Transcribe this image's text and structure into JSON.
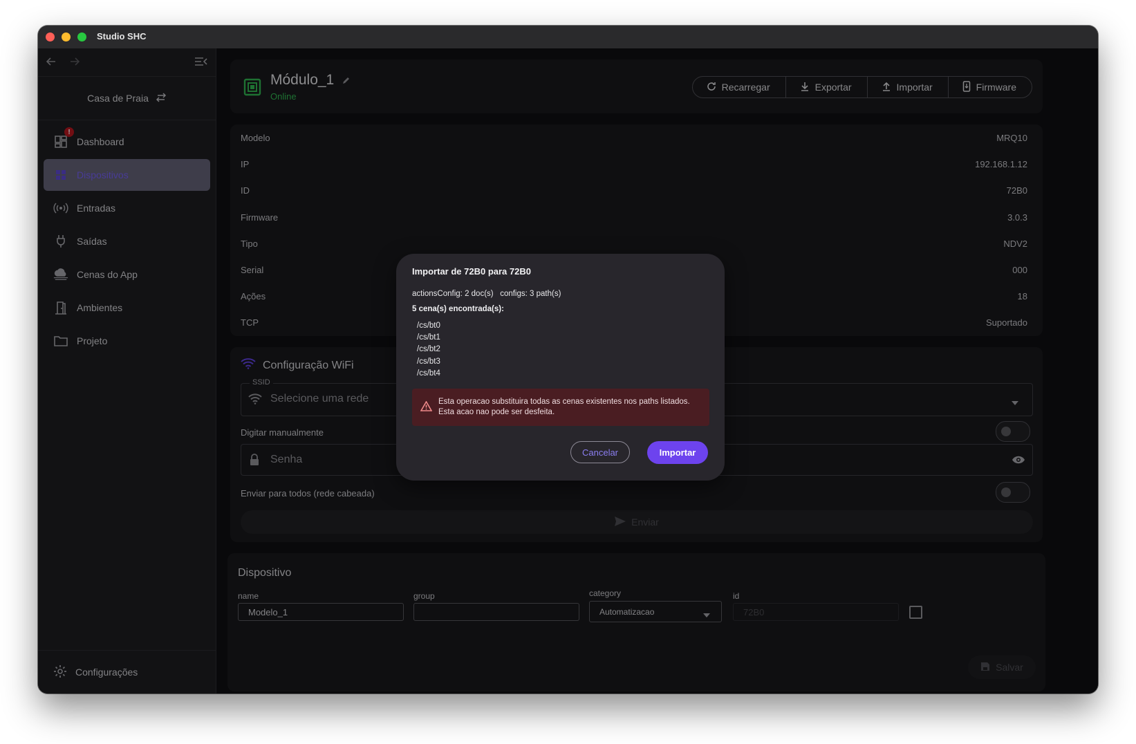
{
  "window": {
    "title": "Studio SHC"
  },
  "sidebar": {
    "house": "Casa de Praia",
    "items": [
      {
        "label": "Dashboard",
        "icon": "dashboard-icon",
        "badge": "!"
      },
      {
        "label": "Dispositivos",
        "icon": "devices-icon",
        "active": true
      },
      {
        "label": "Entradas",
        "icon": "broadcast-icon"
      },
      {
        "label": "Saídas",
        "icon": "plug-icon"
      },
      {
        "label": "Cenas do App",
        "icon": "cloud-icon"
      },
      {
        "label": "Ambientes",
        "icon": "door-icon"
      },
      {
        "label": "Projeto",
        "icon": "folder-icon"
      }
    ],
    "settings": "Configurações"
  },
  "header": {
    "title": "Módulo_1",
    "status": "Online",
    "buttons": {
      "reload": "Recarregar",
      "export": "Exportar",
      "import": "Importar",
      "firmware": "Firmware"
    }
  },
  "info": {
    "rows": [
      {
        "key": "Modelo",
        "value": "MRQ10"
      },
      {
        "key": "IP",
        "value": "192.168.1.12"
      },
      {
        "key": "ID",
        "value": "72B0"
      },
      {
        "key": "Firmware",
        "value": "3.0.3"
      },
      {
        "key": "Tipo",
        "value": "NDV2"
      },
      {
        "key": "Serial",
        "value": "000"
      },
      {
        "key": "Ações",
        "value": "18"
      },
      {
        "key": "TCP",
        "value": "Suportado"
      }
    ]
  },
  "wifi": {
    "title": "Configuração WiFi",
    "ssid_label": "SSID",
    "ssid_placeholder": "Selecione uma rede",
    "manual_label": "Digitar manualmente",
    "password_placeholder": "Senha",
    "broadcast_label": "Enviar para todos (rede cabeada)",
    "send": "Enviar"
  },
  "device": {
    "title": "Dispositivo",
    "name_label": "name",
    "name_value": "Modelo_1",
    "group_label": "group",
    "group_value": "",
    "category_label": "category",
    "category_value": "Automatizacao",
    "id_label": "id",
    "id_value": "72B0",
    "save": "Salvar"
  },
  "dialog": {
    "title": "Importar de 72B0 para 72B0",
    "stats": "actionsConfig: 2 doc(s)   configs: 3 path(s)",
    "count": "5 cena(s) encontrada(s):",
    "paths": [
      "/cs/bt0",
      "/cs/bt1",
      "/cs/bt2",
      "/cs/bt3",
      "/cs/bt4"
    ],
    "warning": "Esta operacao substituira todas as cenas existentes nos paths listados. Esta acao nao pode ser desfeita.",
    "cancel": "Cancelar",
    "confirm": "Importar"
  },
  "colors": {
    "accent": "#6d43ee",
    "online": "#2fae4e",
    "warning_bg": "#4a1d22",
    "badge": "#b0161e"
  }
}
